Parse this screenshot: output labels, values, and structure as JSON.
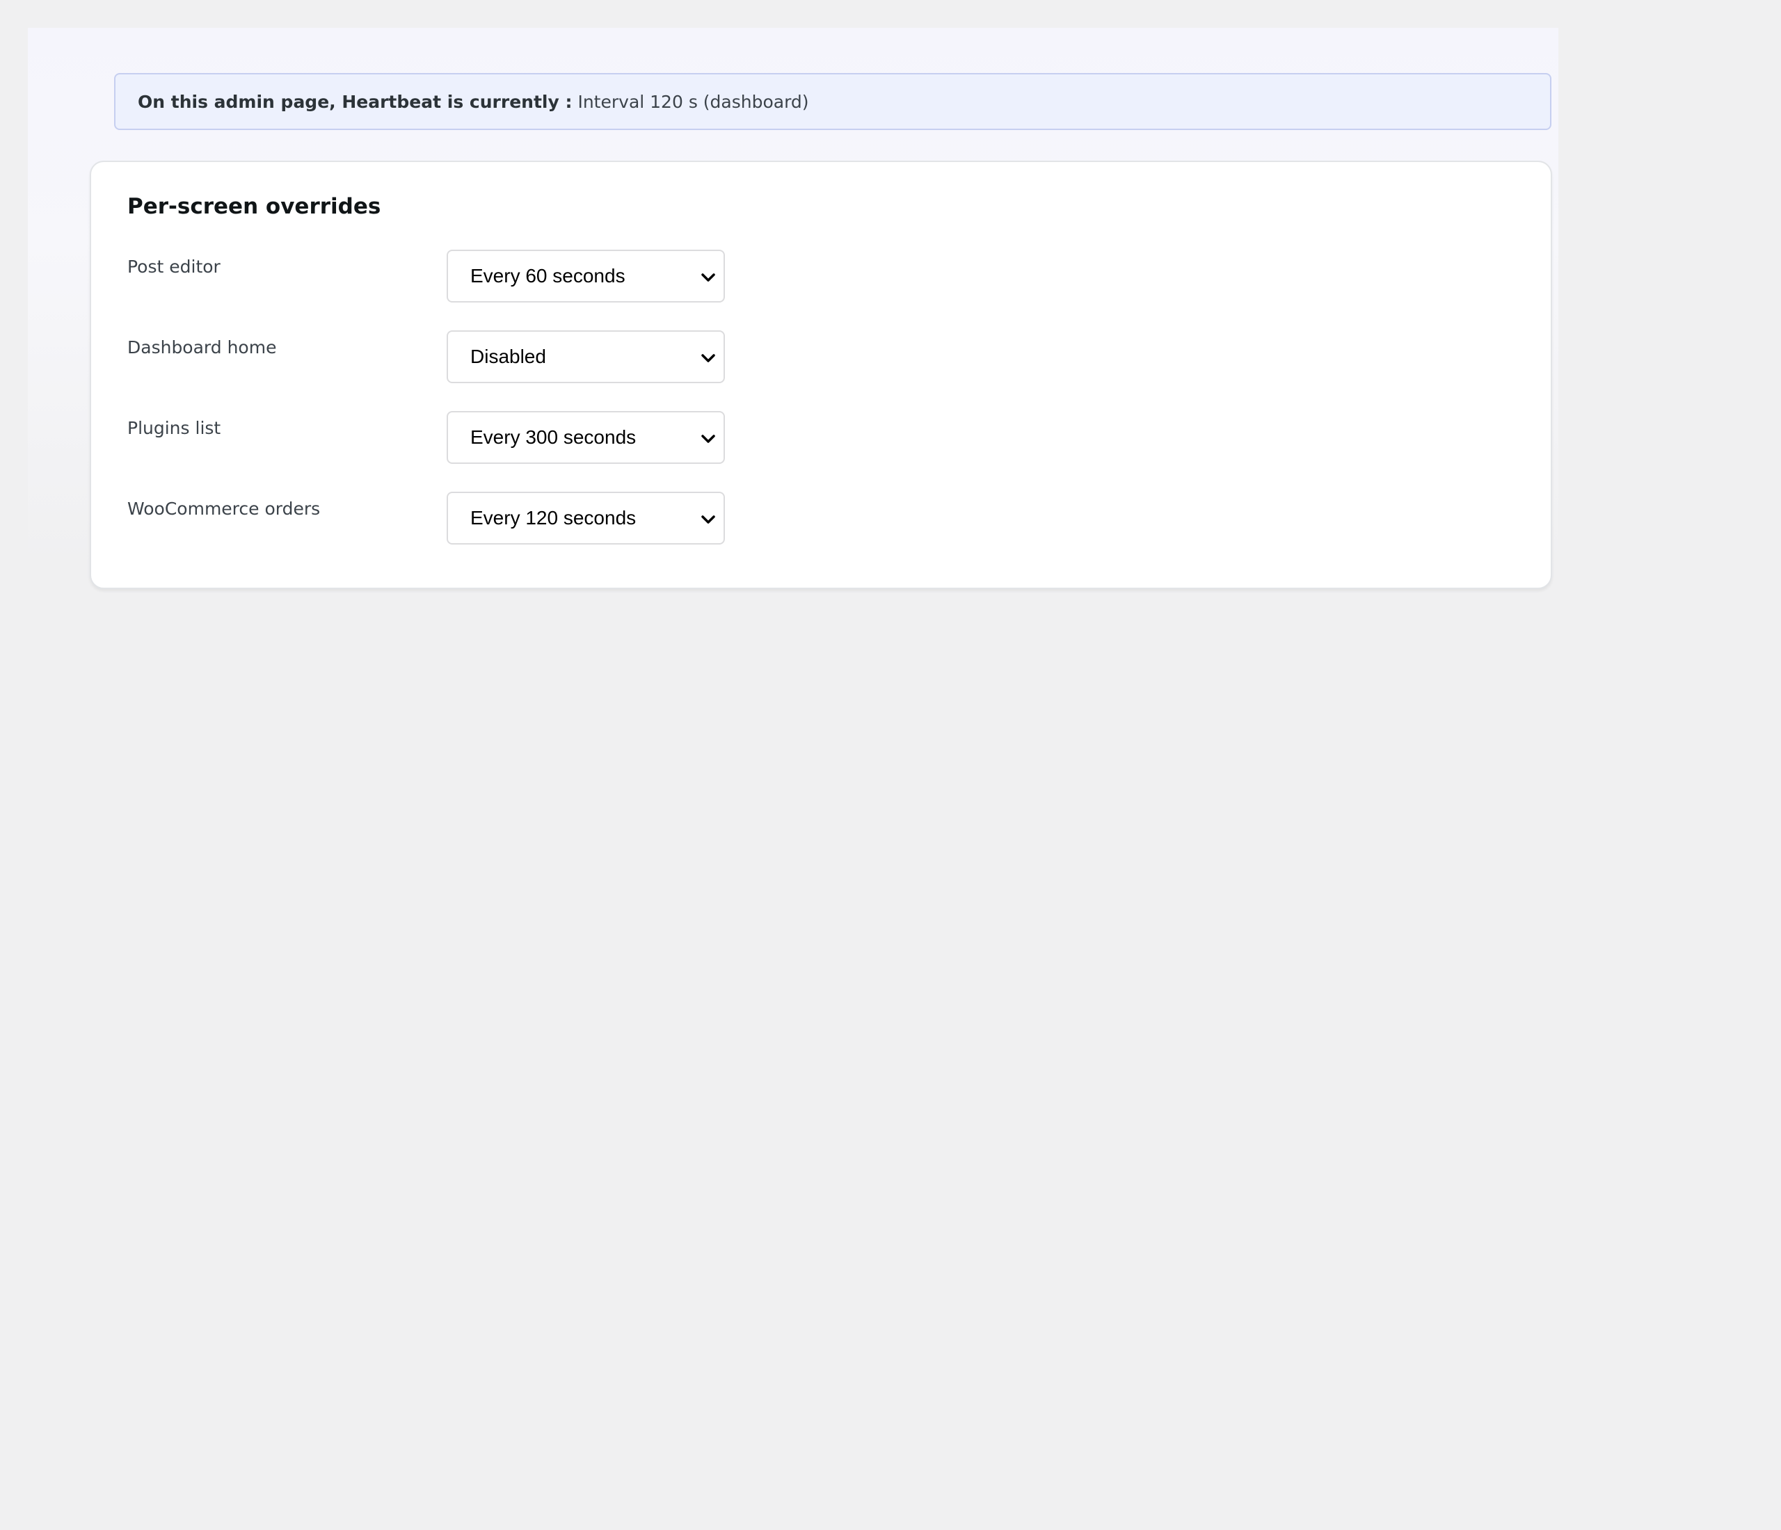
{
  "notice": {
    "label": "On this admin page, Heartbeat is currently :",
    "value": "Interval 120 s (dashboard)"
  },
  "overrides": {
    "title": "Per-screen overrides",
    "rows": [
      {
        "label": "Post editor",
        "selected": "Every 60 seconds"
      },
      {
        "label": "Dashboard home",
        "selected": "Disabled"
      },
      {
        "label": "Plugins list",
        "selected": "Every 300 seconds"
      },
      {
        "label": "WooCommerce orders",
        "selected": "Every 120 seconds"
      }
    ]
  },
  "icons": {
    "select_arrow": "chevron-down-icon"
  }
}
